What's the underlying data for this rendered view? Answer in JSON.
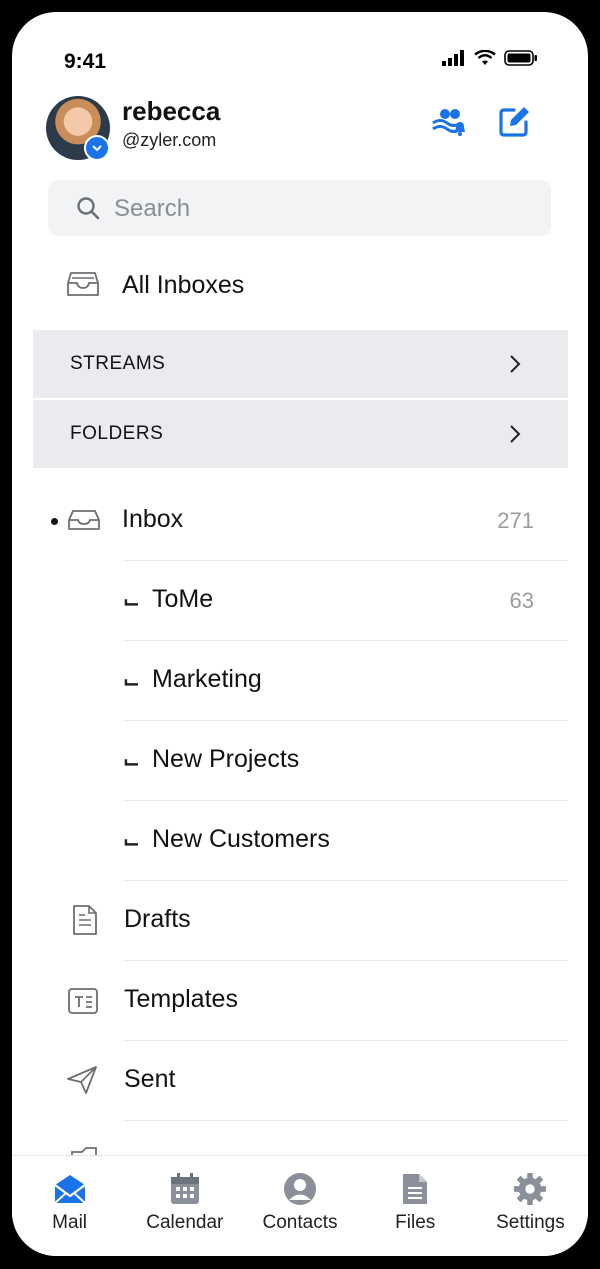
{
  "status_bar": {
    "time": "9:41"
  },
  "header": {
    "user_name": "rebecca",
    "user_domain": "@zyler.com",
    "group_notify_icon": "group-bell-icon",
    "compose_icon": "compose-icon"
  },
  "search": {
    "placeholder": "Search"
  },
  "all_inboxes": {
    "label": "All Inboxes"
  },
  "sections": [
    {
      "label": "STREAMS"
    },
    {
      "label": "FOLDERS"
    }
  ],
  "folders": {
    "inbox": {
      "label": "Inbox",
      "count": "271"
    },
    "subfolders": [
      {
        "label": "ToMe",
        "count": "63"
      },
      {
        "label": "Marketing",
        "count": ""
      },
      {
        "label": "New Projects",
        "count": ""
      },
      {
        "label": "New Customers",
        "count": ""
      }
    ],
    "drafts": {
      "label": "Drafts"
    },
    "templates": {
      "label": "Templates"
    },
    "sent": {
      "label": "Sent"
    }
  },
  "tabbar": {
    "items": [
      {
        "label": "Mail",
        "icon": "mail-icon"
      },
      {
        "label": "Calendar",
        "icon": "calendar-icon"
      },
      {
        "label": "Contacts",
        "icon": "contacts-icon"
      },
      {
        "label": "Files",
        "icon": "files-icon"
      },
      {
        "label": "Settings",
        "icon": "settings-icon"
      }
    ]
  },
  "colors": {
    "accent": "#1a73e8",
    "section_bg": "#e9ebee",
    "count_text": "#9a9ca1"
  }
}
